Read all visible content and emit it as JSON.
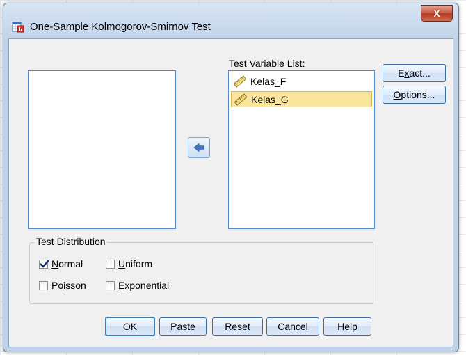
{
  "window": {
    "title": "One-Sample Kolmogorov-Smirnov Test",
    "close_label": "X"
  },
  "variables": {
    "source_items": [],
    "target_label": "Test Variable List:",
    "target_items": [
      {
        "name": "Kelas_F",
        "selected": false,
        "icon": "ruler-scale-icon"
      },
      {
        "name": "Kelas_G",
        "selected": true,
        "icon": "ruler-scale-icon"
      }
    ]
  },
  "side_buttons": {
    "exact": {
      "pre": "E",
      "u": "x",
      "post": "act..."
    },
    "options": {
      "pre": "",
      "u": "O",
      "post": "ptions..."
    }
  },
  "test_distribution": {
    "title": "Test Distribution",
    "normal": {
      "pre": "",
      "u": "N",
      "post": "ormal",
      "checked": true
    },
    "uniform": {
      "pre": "",
      "u": "U",
      "post": "niform",
      "checked": false
    },
    "poisson": {
      "pre": "Po",
      "u": "i",
      "post": "sson",
      "checked": false
    },
    "exponential": {
      "pre": "",
      "u": "E",
      "post": "xponential",
      "checked": false
    }
  },
  "footer_buttons": {
    "ok": "OK",
    "paste": {
      "pre": "",
      "u": "P",
      "post": "aste"
    },
    "reset": {
      "pre": "",
      "u": "R",
      "post": "eset"
    },
    "cancel": "Cancel",
    "help": "Help"
  },
  "colors": {
    "selection": "#fbe49b",
    "list_border": "#4f8ad1",
    "close_button": "#c75a43"
  }
}
